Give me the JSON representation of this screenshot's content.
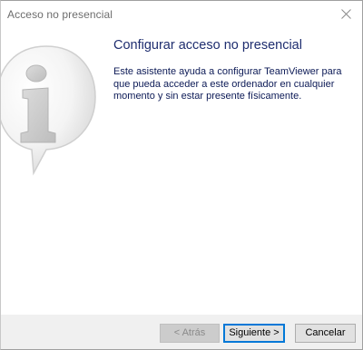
{
  "window": {
    "title": "Acceso no presencial"
  },
  "icons": {
    "close": "close-icon",
    "info": "info-speech-bubble-icon"
  },
  "main": {
    "heading": "Configurar acceso no presencial",
    "description": "Este asistente ayuda a configurar TeamViewer para que pueda acceder a este ordenador en cualquier momento y sin estar presente físicamente."
  },
  "footer": {
    "back_label": "< Atrás",
    "back_enabled": false,
    "next_label": "Siguiente >",
    "cancel_label": "Cancelar"
  },
  "colors": {
    "heading": "#1e2d6f",
    "body_text": "#0c1a56",
    "footer_bg": "#f0f0f0",
    "default_button_border": "#0078d7"
  }
}
